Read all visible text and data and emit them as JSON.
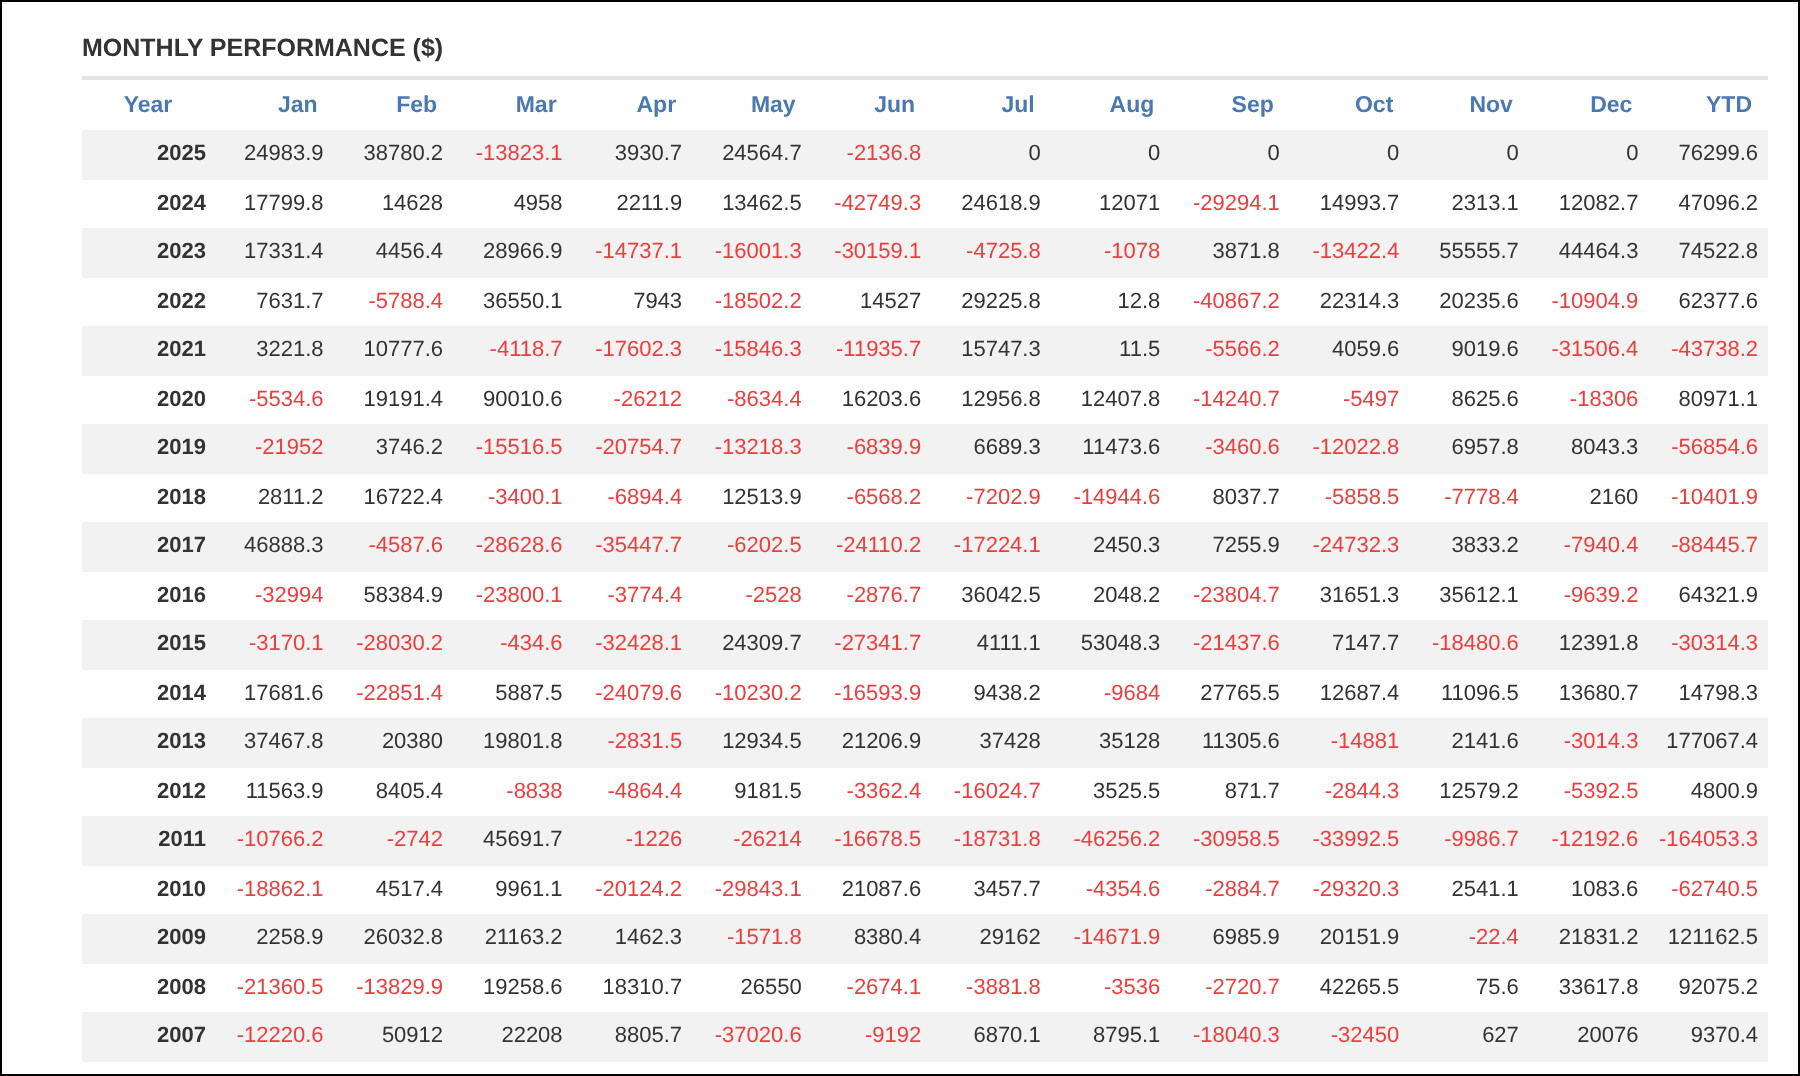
{
  "title": "MONTHLY PERFORMANCE ($)",
  "columns": [
    "Year",
    "Jan",
    "Feb",
    "Mar",
    "Apr",
    "May",
    "Jun",
    "Jul",
    "Aug",
    "Sep",
    "Oct",
    "Nov",
    "Dec",
    "YTD"
  ],
  "rows": [
    {
      "year": "2025",
      "values": [
        "24983.9",
        "38780.2",
        "-13823.1",
        "3930.7",
        "24564.7",
        "-2136.8",
        "0",
        "0",
        "0",
        "0",
        "0",
        "0",
        "76299.6"
      ],
      "negative": [
        false,
        false,
        true,
        false,
        false,
        true,
        false,
        false,
        false,
        false,
        false,
        false,
        false
      ]
    },
    {
      "year": "2024",
      "values": [
        "17799.8",
        "14628",
        "4958",
        "2211.9",
        "13462.5",
        "-42749.3",
        "24618.9",
        "12071",
        "-29294.1",
        "14993.7",
        "2313.1",
        "12082.7",
        "47096.2"
      ],
      "negative": [
        false,
        false,
        false,
        false,
        false,
        true,
        false,
        false,
        true,
        false,
        false,
        false,
        false
      ]
    },
    {
      "year": "2023",
      "values": [
        "17331.4",
        "4456.4",
        "28966.9",
        "-14737.1",
        "-16001.3",
        "-30159.1",
        "-4725.8",
        "-1078",
        "3871.8",
        "-13422.4",
        "55555.7",
        "44464.3",
        "74522.8"
      ],
      "negative": [
        false,
        false,
        false,
        true,
        true,
        true,
        true,
        true,
        false,
        true,
        false,
        false,
        false
      ]
    },
    {
      "year": "2022",
      "values": [
        "7631.7",
        "-5788.4",
        "36550.1",
        "7943",
        "-18502.2",
        "14527",
        "29225.8",
        "12.8",
        "-40867.2",
        "22314.3",
        "20235.6",
        "-10904.9",
        "62377.6"
      ],
      "negative": [
        false,
        true,
        false,
        false,
        true,
        false,
        false,
        false,
        true,
        false,
        false,
        true,
        false
      ]
    },
    {
      "year": "2021",
      "values": [
        "3221.8",
        "10777.6",
        "-4118.7",
        "-17602.3",
        "-15846.3",
        "-11935.7",
        "15747.3",
        "11.5",
        "-5566.2",
        "4059.6",
        "9019.6",
        "-31506.4",
        "-43738.2"
      ],
      "negative": [
        false,
        false,
        true,
        true,
        true,
        true,
        false,
        false,
        true,
        false,
        false,
        true,
        true
      ]
    },
    {
      "year": "2020",
      "values": [
        "-5534.6",
        "19191.4",
        "90010.6",
        "-26212",
        "-8634.4",
        "16203.6",
        "12956.8",
        "12407.8",
        "-14240.7",
        "-5497",
        "8625.6",
        "-18306",
        "80971.1"
      ],
      "negative": [
        true,
        false,
        false,
        true,
        true,
        false,
        false,
        false,
        true,
        true,
        false,
        true,
        false
      ]
    },
    {
      "year": "2019",
      "values": [
        "-21952",
        "3746.2",
        "-15516.5",
        "-20754.7",
        "-13218.3",
        "-6839.9",
        "6689.3",
        "11473.6",
        "-3460.6",
        "-12022.8",
        "6957.8",
        "8043.3",
        "-56854.6"
      ],
      "negative": [
        true,
        false,
        true,
        true,
        true,
        true,
        false,
        false,
        true,
        true,
        false,
        false,
        true
      ]
    },
    {
      "year": "2018",
      "values": [
        "2811.2",
        "16722.4",
        "-3400.1",
        "-6894.4",
        "12513.9",
        "-6568.2",
        "-7202.9",
        "-14944.6",
        "8037.7",
        "-5858.5",
        "-7778.4",
        "2160",
        "-10401.9"
      ],
      "negative": [
        false,
        false,
        true,
        true,
        false,
        true,
        true,
        true,
        false,
        true,
        true,
        false,
        true
      ]
    },
    {
      "year": "2017",
      "values": [
        "46888.3",
        "-4587.6",
        "-28628.6",
        "-35447.7",
        "-6202.5",
        "-24110.2",
        "-17224.1",
        "2450.3",
        "7255.9",
        "-24732.3",
        "3833.2",
        "-7940.4",
        "-88445.7"
      ],
      "negative": [
        false,
        true,
        true,
        true,
        true,
        true,
        true,
        false,
        false,
        true,
        false,
        true,
        true
      ]
    },
    {
      "year": "2016",
      "values": [
        "-32994",
        "58384.9",
        "-23800.1",
        "-3774.4",
        "-2528",
        "-2876.7",
        "36042.5",
        "2048.2",
        "-23804.7",
        "31651.3",
        "35612.1",
        "-9639.2",
        "64321.9"
      ],
      "negative": [
        true,
        false,
        true,
        true,
        true,
        true,
        false,
        false,
        true,
        false,
        false,
        true,
        false
      ]
    },
    {
      "year": "2015",
      "values": [
        "-3170.1",
        "-28030.2",
        "-434.6",
        "-32428.1",
        "24309.7",
        "-27341.7",
        "4111.1",
        "53048.3",
        "-21437.6",
        "7147.7",
        "-18480.6",
        "12391.8",
        "-30314.3"
      ],
      "negative": [
        true,
        true,
        true,
        true,
        false,
        true,
        false,
        false,
        true,
        false,
        true,
        false,
        true
      ]
    },
    {
      "year": "2014",
      "values": [
        "17681.6",
        "-22851.4",
        "5887.5",
        "-24079.6",
        "-10230.2",
        "-16593.9",
        "9438.2",
        "-9684",
        "27765.5",
        "12687.4",
        "11096.5",
        "13680.7",
        "14798.3"
      ],
      "negative": [
        false,
        true,
        false,
        true,
        true,
        true,
        false,
        true,
        false,
        false,
        false,
        false,
        false
      ]
    },
    {
      "year": "2013",
      "values": [
        "37467.8",
        "20380",
        "19801.8",
        "-2831.5",
        "12934.5",
        "21206.9",
        "37428",
        "35128",
        "11305.6",
        "-14881",
        "2141.6",
        "-3014.3",
        "177067.4"
      ],
      "negative": [
        false,
        false,
        false,
        true,
        false,
        false,
        false,
        false,
        false,
        true,
        false,
        true,
        false
      ]
    },
    {
      "year": "2012",
      "values": [
        "11563.9",
        "8405.4",
        "-8838",
        "-4864.4",
        "9181.5",
        "-3362.4",
        "-16024.7",
        "3525.5",
        "871.7",
        "-2844.3",
        "12579.2",
        "-5392.5",
        "4800.9"
      ],
      "negative": [
        false,
        false,
        true,
        true,
        false,
        true,
        true,
        false,
        false,
        true,
        false,
        true,
        false
      ]
    },
    {
      "year": "2011",
      "values": [
        "-10766.2",
        "-2742",
        "45691.7",
        "-1226",
        "-26214",
        "-16678.5",
        "-18731.8",
        "-46256.2",
        "-30958.5",
        "-33992.5",
        "-9986.7",
        "-12192.6",
        "-164053.3"
      ],
      "negative": [
        true,
        true,
        false,
        true,
        true,
        true,
        true,
        true,
        true,
        true,
        true,
        true,
        true
      ]
    },
    {
      "year": "2010",
      "values": [
        "-18862.1",
        "4517.4",
        "9961.1",
        "-20124.2",
        "-29843.1",
        "21087.6",
        "3457.7",
        "-4354.6",
        "-2884.7",
        "-29320.3",
        "2541.1",
        "1083.6",
        "-62740.5"
      ],
      "negative": [
        true,
        false,
        false,
        true,
        true,
        false,
        false,
        true,
        true,
        true,
        false,
        false,
        true
      ]
    },
    {
      "year": "2009",
      "values": [
        "2258.9",
        "26032.8",
        "21163.2",
        "1462.3",
        "-1571.8",
        "8380.4",
        "29162",
        "-14671.9",
        "6985.9",
        "20151.9",
        "-22.4",
        "21831.2",
        "121162.5"
      ],
      "negative": [
        false,
        false,
        false,
        false,
        true,
        false,
        false,
        true,
        false,
        false,
        true,
        false,
        false
      ]
    },
    {
      "year": "2008",
      "values": [
        "-21360.5",
        "-13829.9",
        "19258.6",
        "18310.7",
        "26550",
        "-2674.1",
        "-3881.8",
        "-3536",
        "-2720.7",
        "42265.5",
        "75.6",
        "33617.8",
        "92075.2"
      ],
      "negative": [
        true,
        true,
        false,
        false,
        false,
        true,
        true,
        true,
        true,
        false,
        false,
        false,
        false
      ]
    },
    {
      "year": "2007",
      "values": [
        "-12220.6",
        "50912",
        "22208",
        "8805.7",
        "-37020.6",
        "-9192",
        "6870.1",
        "8795.1",
        "-18040.3",
        "-32450",
        "627",
        "20076",
        "9370.4"
      ],
      "negative": [
        true,
        false,
        false,
        false,
        true,
        true,
        false,
        false,
        true,
        true,
        false,
        false,
        false
      ]
    }
  ]
}
